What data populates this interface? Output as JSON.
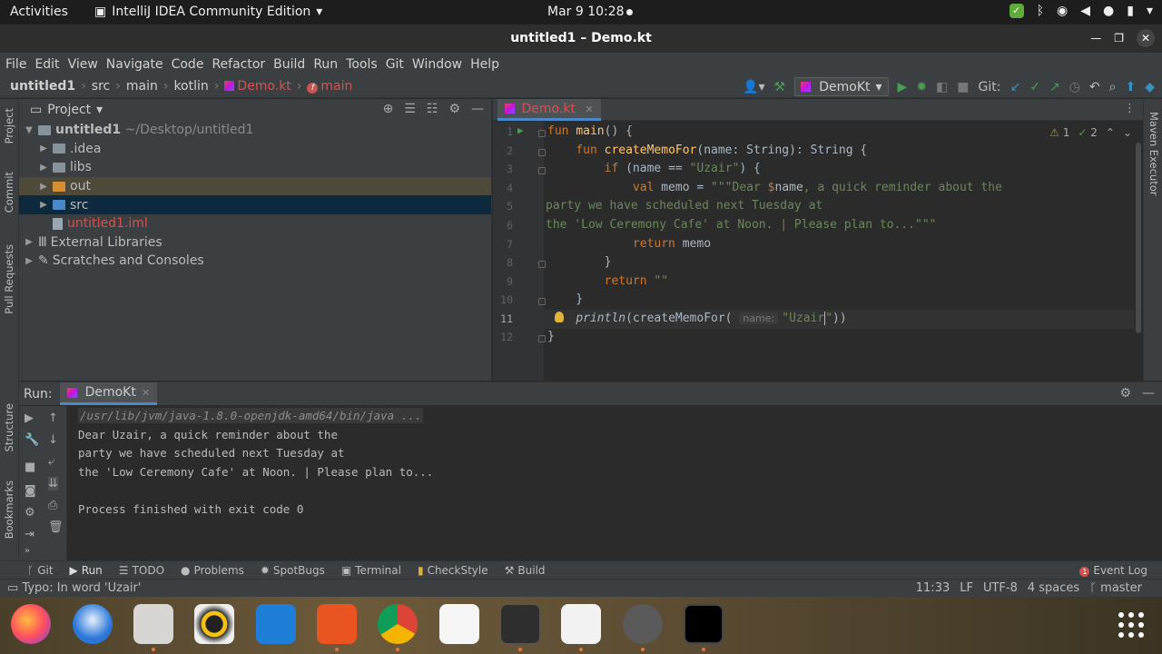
{
  "topbar": {
    "activities": "Activities",
    "app_name": "IntelliJ IDEA Community Edition",
    "clock": "Mar 9  10:28"
  },
  "window": {
    "title": "untitled1 – Demo.kt"
  },
  "menu": [
    "File",
    "Edit",
    "View",
    "Navigate",
    "Code",
    "Refactor",
    "Build",
    "Run",
    "Tools",
    "Git",
    "Window",
    "Help"
  ],
  "breadcrumb": {
    "project": "untitled1",
    "p1": "src",
    "p2": "main",
    "p3": "kotlin",
    "file": "Demo.kt",
    "func": "main"
  },
  "toolbar": {
    "run_config": "DemoKt",
    "git_label": "Git:"
  },
  "side_tabs": {
    "project": "Project",
    "commit": "Commit",
    "pull_requests": "Pull Requests",
    "structure": "Structure",
    "bookmarks": "Bookmarks",
    "maven": "Maven Executor"
  },
  "project_panel": {
    "title": "Project",
    "root_name": "untitled1",
    "root_path": "~/Desktop/untitled1",
    "items": [
      ".idea",
      "libs",
      "out",
      "src",
      "untitled1.iml",
      "External Libraries",
      "Scratches and Consoles"
    ]
  },
  "editor": {
    "tab": "Demo.kt",
    "inspections": {
      "warnings": "1",
      "typos": "2"
    },
    "line_numbers": [
      "1",
      "2",
      "3",
      "4",
      "5",
      "6",
      "7",
      "8",
      "9",
      "10",
      "11",
      "12"
    ],
    "lines": [
      "fun main() {",
      "    fun createMemoFor(name: String): String {",
      "        if (name == \"Uzair\") {",
      "            val memo = \"\"\"Dear $name, a quick reminder about the",
      "party we have scheduled next Tuesday at",
      "the 'Low Ceremony Cafe' at Noon. | Please plan to...\"\"\"",
      "            return memo",
      "        }",
      "        return \"\"",
      "    }",
      "    println(createMemoFor( name: \"Uzair\"))",
      "}"
    ],
    "param_hint": "name:"
  },
  "run_panel": {
    "label": "Run:",
    "tab": "DemoKt",
    "command": "/usr/lib/jvm/java-1.8.0-openjdk-amd64/bin/java ...",
    "output": [
      "Dear Uzair, a quick reminder about the",
      "party we have scheduled next Tuesday at",
      "the 'Low Ceremony Cafe' at Noon. | Please plan to...",
      "",
      "Process finished with exit code 0"
    ]
  },
  "tool_windows": [
    "Git",
    "Run",
    "TODO",
    "Problems",
    "SpotBugs",
    "Terminal",
    "CheckStyle",
    "Build"
  ],
  "event_log": "Event Log",
  "status": {
    "message": "Typo: In word 'Uzair'",
    "position": "11:33",
    "line_sep": "LF",
    "encoding": "UTF-8",
    "indent": "4 spaces",
    "branch": "master"
  },
  "dock_apps": [
    "firefox-icon",
    "thunderbird-icon",
    "files-icon",
    "rhythmbox-icon",
    "libreoffice-writer-icon",
    "software-center-icon",
    "chrome-icon",
    "text-editor-icon",
    "terminal-icon",
    "document-viewer-icon",
    "software-updater-icon",
    "intellij-icon"
  ],
  "colors": {
    "accent": "#4a88c7",
    "keyword": "#cc7832",
    "string": "#6a8759",
    "function": "#ffc66d",
    "error": "#d25252"
  }
}
